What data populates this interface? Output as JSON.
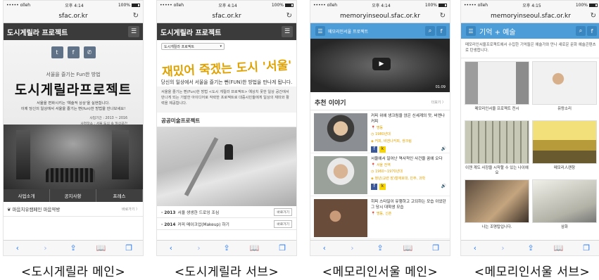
{
  "colors": {
    "dark_header": "#3b3b3b",
    "blue_header": "#4d9dd9",
    "accent_yellow": "#e0a200",
    "ios_blue": "#2e7cf6"
  },
  "phones": [
    {
      "status": {
        "carrier": "••••• olleh",
        "time": "오후 4:14",
        "battery": "100%"
      },
      "url": "sfac.or.kr",
      "header_title": "도시게릴라 프로젝트",
      "hero_sub": "서울을 즐기는 Fun한 방법",
      "hero_title": "도시게릴라프로젝트",
      "hero_desc1": "서울을 변화시키는 '예술적 상상'을 실현합니다.",
      "hero_desc2": "이제 당신의 일상에서 서울을 즐기는 뻔(fun)한 방법을 만나보세요!",
      "meta1": "사업기간 : 2013 ~ 2016",
      "meta2": "사업장소 : 서울 도심 속 일상공간",
      "tabs": [
        "사업소개",
        "공지사항",
        "프레스"
      ],
      "campaign": "마음치유캠페인 마음약방",
      "more": "바로가기 〉"
    },
    {
      "status": {
        "carrier": "••••• olleh",
        "time": "오후 4:14",
        "battery": "100%"
      },
      "url": "sfac.or.kr",
      "header_title": "도시게릴라 프로젝트",
      "select": "도시게릴라 프로젝트",
      "callig": "재밌어 죽겠는 도시 '서울'",
      "tagline": "당신의 일상에서 서울을 즐기는 뻔(FUN)한 방법을 만나게 됩니다.",
      "body": "서울을 즐기는 뻔(Fun)한 방법 <도시 게릴라 프로젝트> 예상치 못한 일상 공간에서 만나게 되는 기발한 아이디어로 작략한 프로젝트로 대중시민들에게 일상의 재미와 활력을 제공합니다.",
      "section": "공공미술프로젝트",
      "rows": [
        {
          "year": "· 2013",
          "text": "서울 생생한 드로잉 조심",
          "btn": "바로가기"
        },
        {
          "year": "· 2014",
          "text": "커피 메이크업(Makeup) 하기",
          "btn": "바로가기"
        }
      ]
    },
    {
      "status": {
        "carrier": "••••• olleh",
        "time": "오후 4:14",
        "battery": "100%"
      },
      "url": "memoryinseoul.sfac.or.kr",
      "logo": "메모리인서울 프로젝트",
      "video_time": "01:09",
      "section": "추천 이야기",
      "more": "더보기 〉",
      "stories": [
        {
          "title": "커피 위에 생크림을 얹은 신세계의 맛, 비엔나 커피",
          "loc": "명동",
          "year": "1980년대",
          "tags": "커피, 비엔나커피, 생크림"
        },
        {
          "title": "서울에서 일어난 역사적인 사건을 꿈에 오다",
          "loc": "서울 전역",
          "year": "1960~1970년대",
          "tags": "청년(교련 장)철애호대, 민주, 과학"
        },
        {
          "title": "히피 스타일이 유행하고 고되하는 모습 이었던 그 당시 대학생 모습",
          "loc": "명동, 신촌",
          "year": "",
          "tags": ""
        }
      ]
    },
    {
      "status": {
        "carrier": "••••• olleh",
        "time": "오후 4:15",
        "battery": "100%"
      },
      "url": "memoryinseoul.sfac.or.kr",
      "header_title": "기억 + 예술",
      "intro": "메모리인서울프로젝트에서 수집한 기억들은 예술가와 만나 새로운 문화 예술콘텐츠로 탄생합니다.",
      "tiles": [
        "메모리인서울 프로젝트 전시",
        "유랑소리",
        "이젠 계도 사장을 시작할 수 있는 나이예요",
        "메모리人랜창",
        "나는 조명탑입니다.",
        "삼화"
      ]
    }
  ],
  "captions": [
    "<도시게릴라 메인>",
    "<도시게릴라 서브>",
    "<메모리인서울 메인>",
    "<메모리인서울 서브>"
  ],
  "toolbar_icons": [
    "back-icon",
    "forward-icon",
    "share-icon",
    "bookmarks-icon",
    "tabs-icon"
  ]
}
